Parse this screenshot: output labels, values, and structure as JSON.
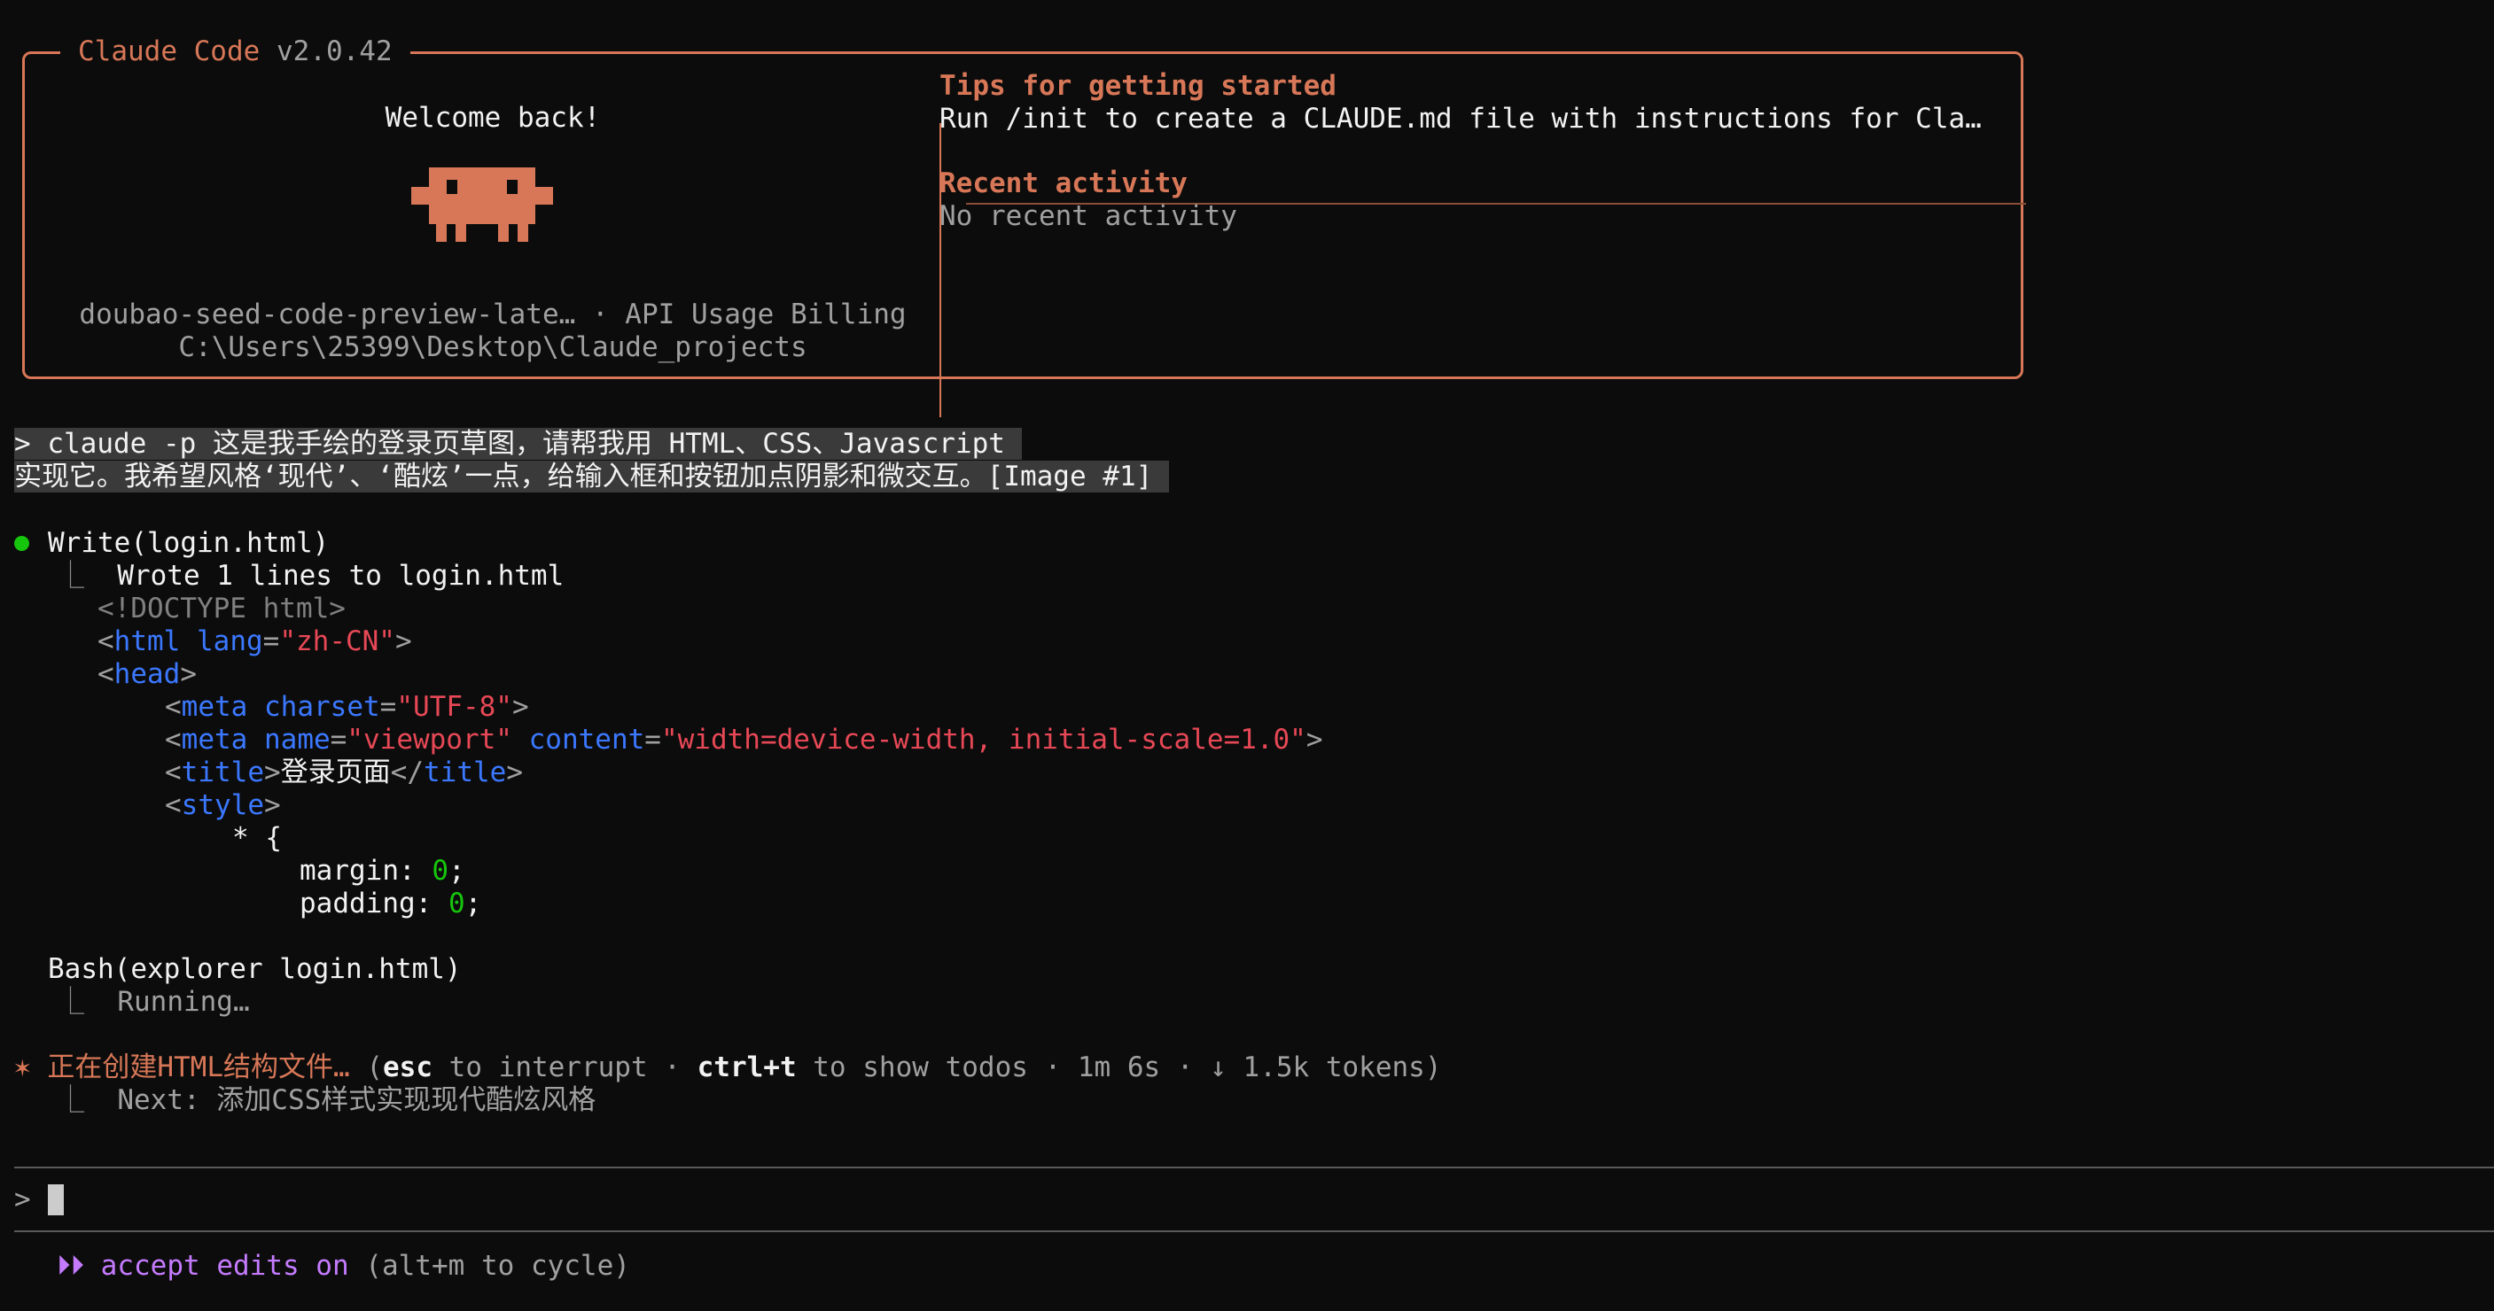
{
  "app": {
    "name": "Claude Code",
    "version": "v2.0.42"
  },
  "welcome": {
    "greeting": "Welcome back!",
    "model_line": "doubao-seed-code-preview-late… · API Usage Billing",
    "cwd": "C:\\Users\\25399\\Desktop\\Claude_projects"
  },
  "tips": {
    "heading": "Tips for getting started",
    "text": "Run /init to create a CLAUDE.md file with instructions for Cla…"
  },
  "recent": {
    "heading": "Recent activity",
    "text": "No recent activity"
  },
  "prompt": {
    "line1": "> claude -p 这是我手绘的登录页草图，请帮我用 HTML、CSS、Javascript ",
    "line2": "实现它。我希望风格‘现代’、‘酷炫’一点，给输入框和按钮加点阴影和微交互。[Image #1] "
  },
  "write_tool": {
    "label": "Write",
    "arg": "(login.html)",
    "result_prefix": "⎿  ",
    "result": "Wrote 1 lines to login.html"
  },
  "code": {
    "doctype": "<!DOCTYPE html>",
    "html_tag": "html",
    "html_attr": "lang",
    "html_attr_val": "\"zh-CN\"",
    "head_tag": "head",
    "meta_tag": "meta",
    "charset_attr": "charset",
    "charset_val": "\"UTF-8\"",
    "name_attr": "name",
    "name_val": "\"viewport\"",
    "content_attr": "content",
    "content_val": "\"width=device-width, initial-scale=1.0\"",
    "title_tag": "title",
    "title_text": "登录页面",
    "style_tag": "style",
    "selector": "* {",
    "margin_prop": "margin: ",
    "padding_prop": "padding: ",
    "zero": "0",
    "semicolon": ";"
  },
  "bash_tool": {
    "label": "Bash",
    "arg": "(explorer login.html)",
    "status": "Running…"
  },
  "status": {
    "spinner": "✶",
    "task": "正在创建HTML结构文件…",
    "open": " (",
    "esc": "esc",
    "esc_hint": " to interrupt · ",
    "ctrl": "ctrl+t",
    "ctrl_hint": " to show todos · 1m 6s · ↓ 1.5k tokens)",
    "next": "Next: 添加CSS样式实现现代酷炫风格"
  },
  "input": {
    "prompt_symbol": ">"
  },
  "footer": {
    "icon": "⏵⏵",
    "mode": "accept edits on",
    "hint": " (alt+m to cycle)"
  },
  "colors": {
    "accent": "#d77757",
    "background": "#0c0c0c",
    "success": "#16c60c",
    "mode": "#c57bff"
  }
}
